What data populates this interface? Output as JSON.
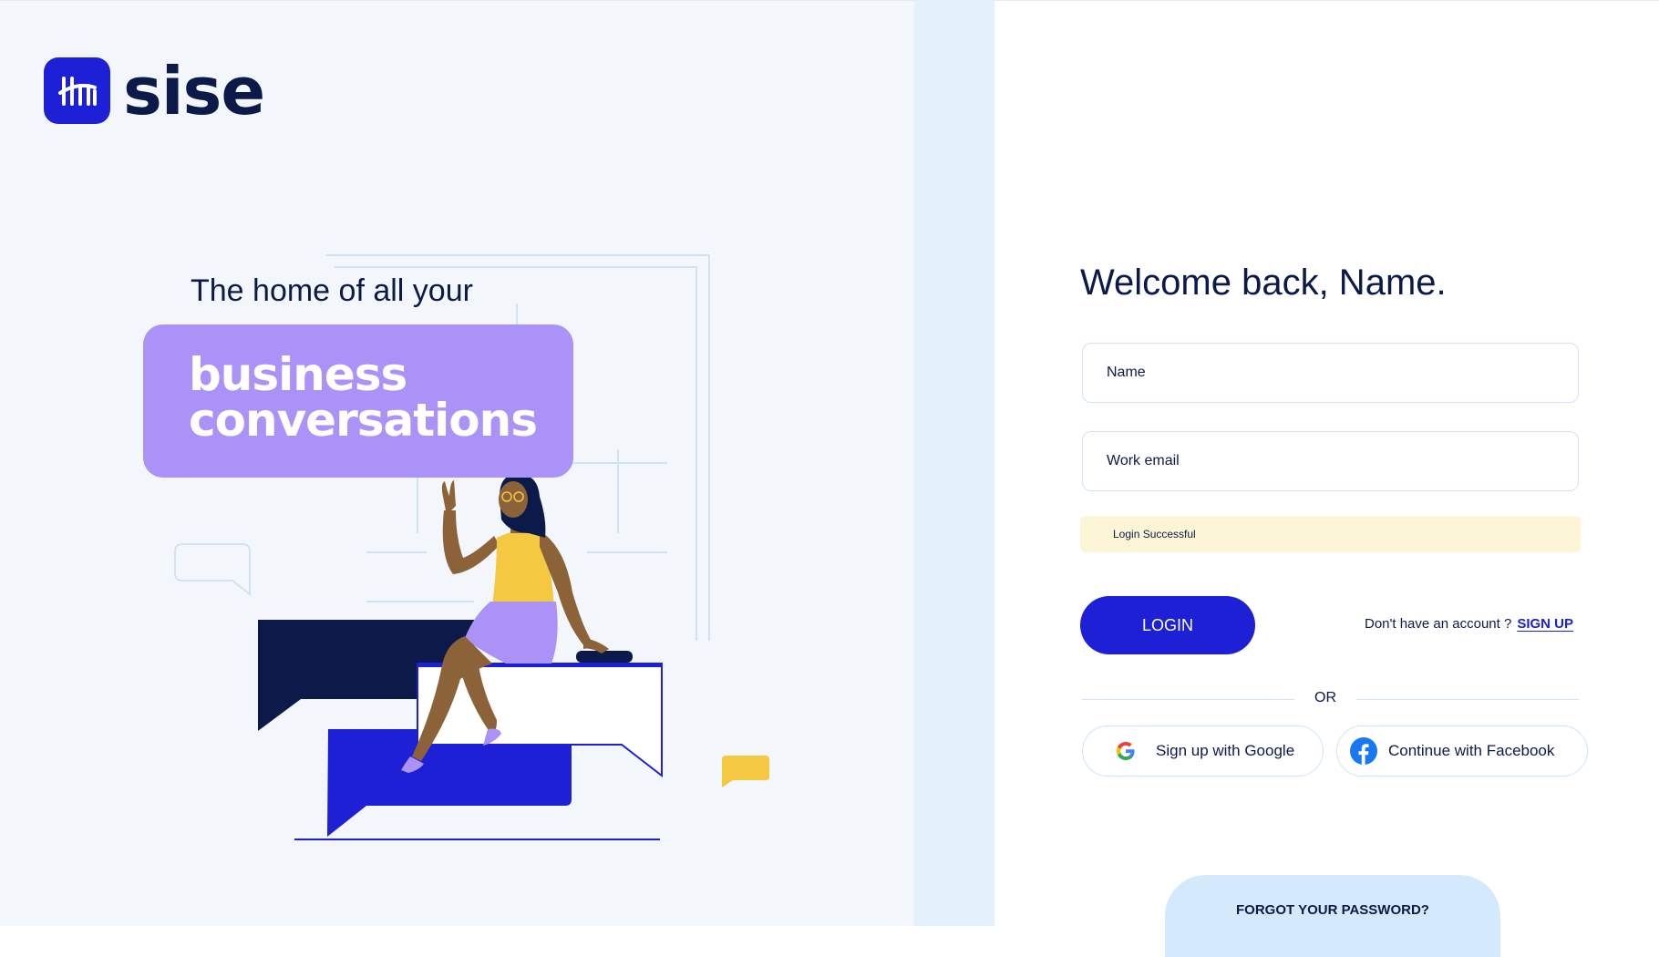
{
  "brand": {
    "name": "sise",
    "accent": "#1d20d4",
    "dark": "#0c1a4a",
    "purple": "#ab92f7",
    "yellow": "#f5c842"
  },
  "hero": {
    "tagline": "The home of all your",
    "headline_line1": "business",
    "headline_line2": "conversations"
  },
  "form": {
    "title": "Welcome back, Name.",
    "name_placeholder": "Name",
    "email_placeholder": "Work email",
    "alert": "Login Successful",
    "login_label": "LOGIN",
    "no_account_text": "Don't have an account ?",
    "signup_label": "SIGN UP",
    "or_label": "OR",
    "google_label": "Sign up with Google",
    "facebook_label": "Continue with Facebook",
    "forgot_label": "FORGOT YOUR PASSWORD?"
  },
  "icons": {
    "logo": "sise-logo-icon",
    "google": "google-icon",
    "facebook": "facebook-icon"
  }
}
